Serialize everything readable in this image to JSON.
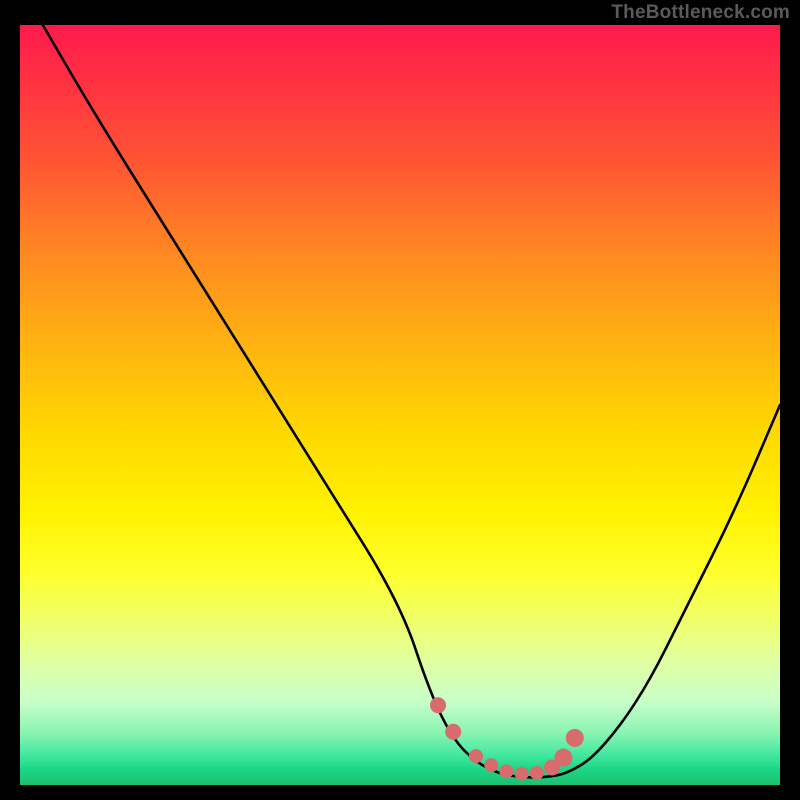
{
  "watermark": "TheBottleneck.com",
  "chart_data": {
    "type": "line",
    "title": "",
    "xlabel": "",
    "ylabel": "",
    "xlim": [
      0,
      100
    ],
    "ylim": [
      0,
      100
    ],
    "series": [
      {
        "name": "bottleneck-curve",
        "x": [
          3,
          10,
          20,
          30,
          40,
          50,
          54,
          57,
          60,
          63,
          66,
          69,
          72,
          76,
          82,
          88,
          94,
          100
        ],
        "y": [
          100,
          88,
          72,
          56,
          40,
          24,
          12,
          6,
          3,
          1.5,
          1,
          1,
          1.5,
          4,
          12,
          24,
          36,
          50
        ]
      }
    ],
    "overlay_points": {
      "name": "highlight-dots",
      "color": "#d86b6b",
      "x": [
        55,
        57,
        60,
        62,
        64,
        66,
        68,
        70,
        71.5,
        73
      ],
      "y": [
        10.5,
        7,
        3.8,
        2.6,
        1.8,
        1.5,
        1.6,
        2.3,
        3.6,
        6.2
      ],
      "r": [
        8,
        8,
        7,
        7,
        7,
        7,
        7,
        8,
        9,
        9
      ]
    },
    "gradient_stops": [
      {
        "pos": 0,
        "color": "#ff1a4d"
      },
      {
        "pos": 18,
        "color": "#ff5533"
      },
      {
        "pos": 42,
        "color": "#ffb311"
      },
      {
        "pos": 64,
        "color": "#fff200"
      },
      {
        "pos": 84,
        "color": "#e0ffa3"
      },
      {
        "pos": 96,
        "color": "#44e8a0"
      },
      {
        "pos": 100,
        "color": "#1cc06e"
      }
    ]
  }
}
